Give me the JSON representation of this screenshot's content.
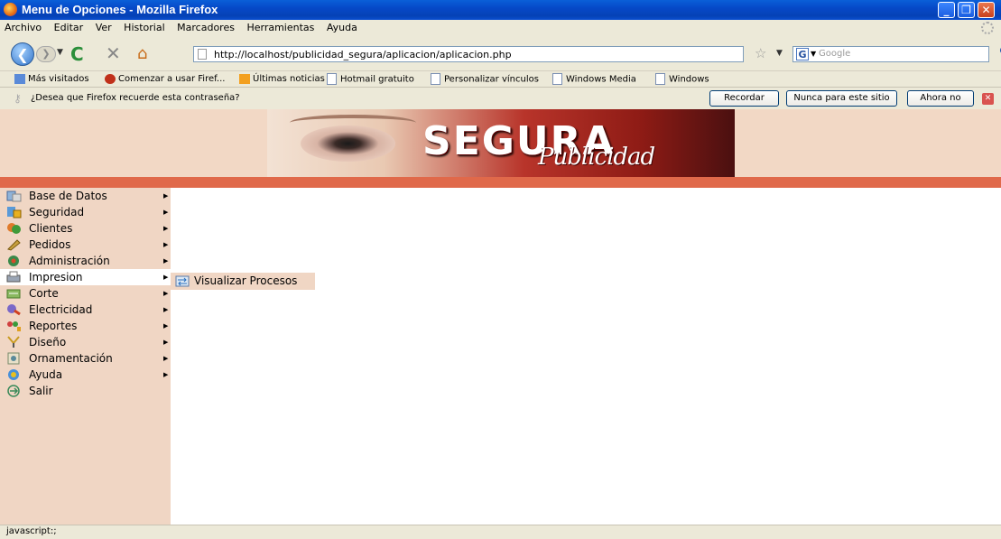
{
  "window": {
    "title": "Menu de Opciones - Mozilla Firefox"
  },
  "menubar": [
    "Archivo",
    "Editar",
    "Ver",
    "Historial",
    "Marcadores",
    "Herramientas",
    "Ayuda"
  ],
  "nav": {
    "url": "http://localhost/publicidad_segura/aplicacion/aplicacion.php",
    "search_placeholder": "Google"
  },
  "bookmarks": [
    "Más visitados",
    "Comenzar a usar Firef...",
    "Últimas noticias",
    "Hotmail gratuito",
    "Personalizar vínculos",
    "Windows Media",
    "Windows"
  ],
  "notification": {
    "text": "¿Desea que Firefox recuerde esta contraseña?",
    "remember": "Recordar",
    "never": "Nunca para este sitio",
    "not_now": "Ahora no"
  },
  "banner": {
    "brand": "SEGURA",
    "script": "Publicidad"
  },
  "menu": [
    {
      "label": "Base de Datos",
      "icon": "database-icon",
      "arrow": "▶"
    },
    {
      "label": "Seguridad",
      "icon": "security-icon",
      "arrow": "▶"
    },
    {
      "label": "Clientes",
      "icon": "clients-icon",
      "arrow": "▶"
    },
    {
      "label": "Pedidos",
      "icon": "orders-icon",
      "arrow": "▶"
    },
    {
      "label": "Administración",
      "icon": "admin-icon",
      "arrow": "▶"
    },
    {
      "label": "Impresion",
      "icon": "print-icon",
      "arrow": "▶"
    },
    {
      "label": "Corte",
      "icon": "cut-icon",
      "arrow": "▶"
    },
    {
      "label": "Electricidad",
      "icon": "electricity-icon",
      "arrow": "▶"
    },
    {
      "label": "Reportes",
      "icon": "reports-icon",
      "arrow": "▶"
    },
    {
      "label": "Diseño",
      "icon": "design-icon",
      "arrow": "▶"
    },
    {
      "label": "Ornamentación",
      "icon": "ornament-icon",
      "arrow": "▶"
    },
    {
      "label": "Ayuda",
      "icon": "help-icon",
      "arrow": "▶"
    },
    {
      "label": "Salir",
      "icon": "exit-icon",
      "arrow": ""
    }
  ],
  "submenu": {
    "label": "Visualizar Procesos",
    "icon": "process-icon"
  },
  "status": {
    "text": "javascript:;"
  }
}
